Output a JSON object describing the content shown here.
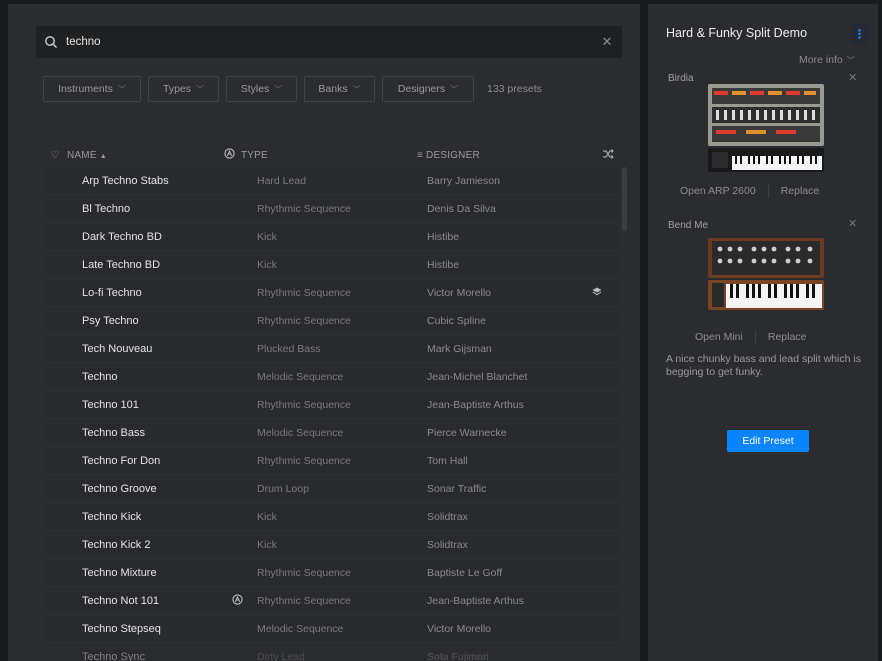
{
  "search": {
    "query": "techno",
    "clear_icon": "close-icon",
    "search_icon": "search-icon"
  },
  "filters": {
    "buttons": [
      "Instruments",
      "Types",
      "Styles",
      "Banks",
      "Designers"
    ],
    "count": "133 presets"
  },
  "table": {
    "headers": {
      "name": "NAME",
      "type": "TYPE",
      "designer": "DESIGNER"
    },
    "rows": [
      {
        "name": "Arp Techno Stabs",
        "type": "Hard Lead",
        "designer": "Barry Jamieson"
      },
      {
        "name": "Bl Techno",
        "type": "Rhythmic Sequence",
        "designer": "Denis Da Silva"
      },
      {
        "name": "Dark Techno BD",
        "type": "Kick",
        "designer": "Histibe"
      },
      {
        "name": "Late Techno BD",
        "type": "Kick",
        "designer": "Histibe"
      },
      {
        "name": "Lo-fi Techno",
        "type": "Rhythmic Sequence",
        "designer": "Victor Morello",
        "icon": "layers-icon"
      },
      {
        "name": "Psy Techno",
        "type": "Rhythmic Sequence",
        "designer": "Cubic Spline"
      },
      {
        "name": "Tech Nouveau",
        "type": "Plucked Bass",
        "designer": "Mark Gijsman"
      },
      {
        "name": "Techno",
        "type": "Melodic Sequence",
        "designer": "Jean-Michel Blanchet"
      },
      {
        "name": "Techno 101",
        "type": "Rhythmic Sequence",
        "designer": "Jean-Baptiste Arthus"
      },
      {
        "name": "Techno Bass",
        "type": "Melodic Sequence",
        "designer": "Pierce Warnecke"
      },
      {
        "name": "Techno For Don",
        "type": "Rhythmic Sequence",
        "designer": "Tom Hall"
      },
      {
        "name": "Techno Groove",
        "type": "Drum Loop",
        "designer": "Sonar Traffic"
      },
      {
        "name": "Techno Kick",
        "type": "Kick",
        "designer": "Solidtrax"
      },
      {
        "name": "Techno Kick 2",
        "type": "Kick",
        "designer": "Solidtrax"
      },
      {
        "name": "Techno Mixture",
        "type": "Rhythmic Sequence",
        "designer": "Baptiste Le Goff"
      },
      {
        "name": "Techno Not 101",
        "type": "Rhythmic Sequence",
        "designer": "Jean-Baptiste Arthus",
        "arturia": true
      },
      {
        "name": "Techno Stepseq",
        "type": "Melodic Sequence",
        "designer": "Victor Morello"
      },
      {
        "name": "Techno Sync",
        "type": "Dirty Lead",
        "designer": "Sota Fujimori"
      }
    ]
  },
  "panel": {
    "title": "Hard & Funky Split Demo",
    "menu_icon": "kebab-menu-icon",
    "more_info": "More info",
    "instruments": [
      {
        "label": "Birdia",
        "open": "Open ARP 2600",
        "replace": "Replace"
      },
      {
        "label": "Bend Me",
        "open": "Open Mini",
        "replace": "Replace"
      }
    ],
    "description": "A nice chunky bass and lead split which is begging to get funky.",
    "edit_button": "Edit Preset"
  },
  "colors": {
    "accent": "#0a84ff",
    "background": "#2b2c2f"
  }
}
